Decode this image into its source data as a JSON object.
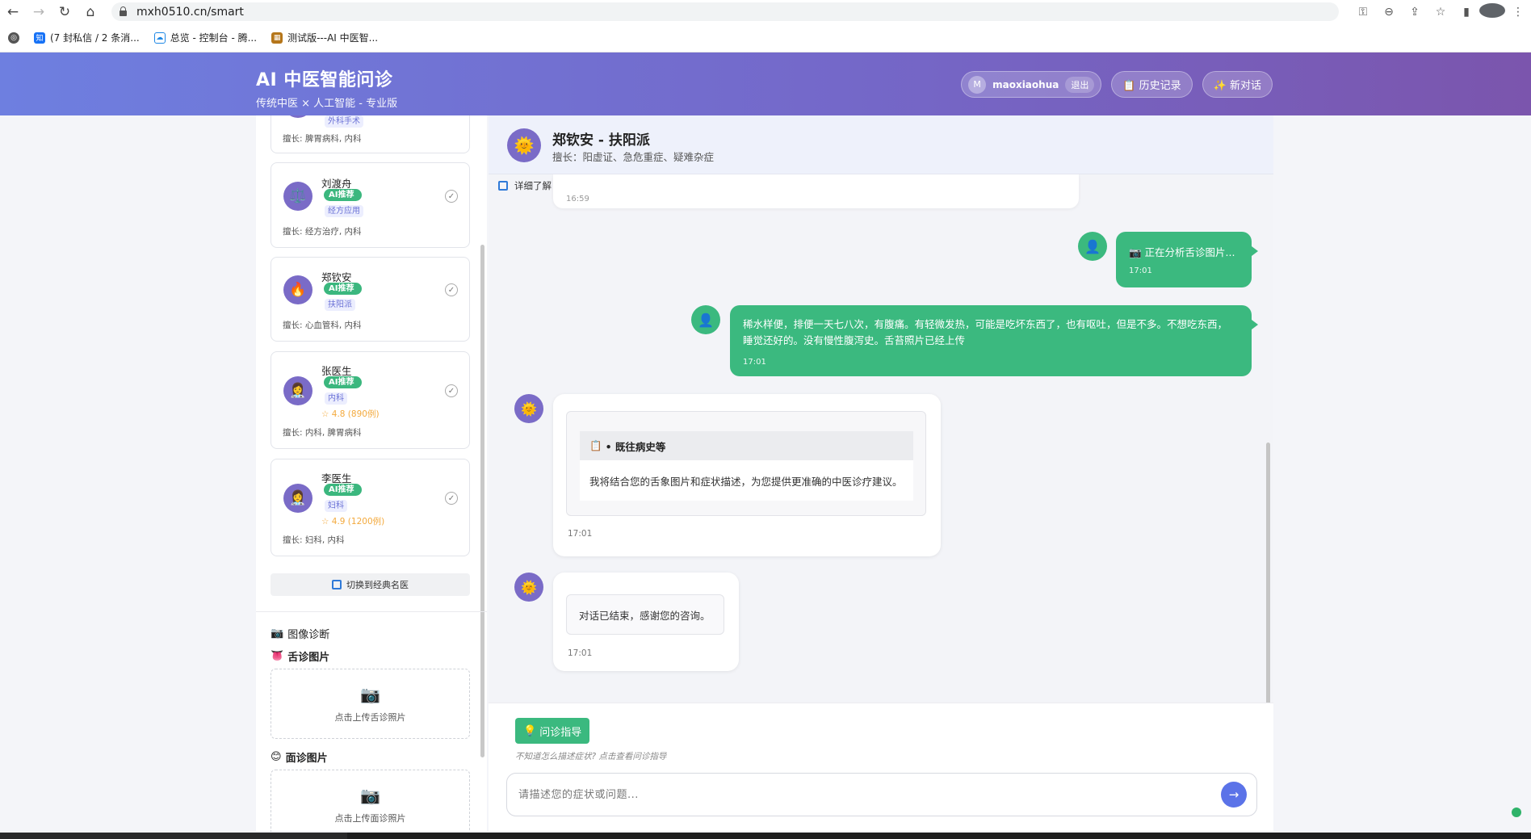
{
  "browser": {
    "url": "mxh0510.cn/smart",
    "bookmarks": [
      {
        "icon": "zhihu-icon",
        "label": "(7 封私信 / 2 条消..."
      },
      {
        "icon": "cloud-icon",
        "label": "总览 - 控制台 - 腾..."
      },
      {
        "icon": "app-icon",
        "label": "测试版---AI 中医智..."
      }
    ]
  },
  "header": {
    "title": "AI 中医智能问诊",
    "subtitle": "传统中医 × 人工智能 - 专业版",
    "user_initial": "M",
    "username": "maoxiaohua",
    "logout_label": "退出",
    "history_label": "📋 历史记录",
    "new_chat_label": "✨ 新对话"
  },
  "sidebar": {
    "partial_card": {
      "tag": "外科手术",
      "specialty": "擅长: 脾胃病科, 内科"
    },
    "doctors": [
      {
        "name": "刘渡舟",
        "badge": "AI推荐",
        "tag": "经方应用",
        "specialty": "擅长: 经方治疗, 内科",
        "rating": "",
        "avatar_icon": "⚖️"
      },
      {
        "name": "郑钦安",
        "badge": "AI推荐",
        "tag": "扶阳派",
        "specialty": "擅长: 心血管科, 内科",
        "rating": "",
        "avatar_icon": "🔥"
      },
      {
        "name": "张医生",
        "badge": "AI推荐",
        "tag": "内科",
        "specialty": "擅长: 内科, 脾胃病科",
        "rating": "4.8 (890例)",
        "avatar_icon": "👩‍⚕️"
      },
      {
        "name": "李医生",
        "badge": "AI推荐",
        "tag": "妇科",
        "specialty": "擅长: 妇科, 内科",
        "rating": "4.9 (1200例)",
        "avatar_icon": "👩‍⚕️"
      }
    ],
    "check_mark": "✓",
    "switch_label": "切换到经典名医",
    "image_diag_title": "图像诊断",
    "tongue_title": "舌诊图片",
    "tongue_upload": "点击上传舌诊照片",
    "face_title": "面诊图片",
    "face_upload": "点击上传面诊照片"
  },
  "chat": {
    "doctor_title": "郑钦安 - 扶阳派",
    "doctor_specialty": "擅长：阳虚证、急危重症、疑难杂症",
    "detail_link": "详细了解",
    "partial_time": "16:59",
    "messages": [
      {
        "role": "user",
        "text": "📷 正在分析舌诊图片...",
        "time": "17:01"
      },
      {
        "role": "user",
        "text": "稀水样便，排便一天七八次，有腹痛。有轻微发热，可能是吃坏东西了，也有呕吐，但是不多。不想吃东西，睡觉还好的。没有慢性腹泻史。舌苔照片已经上传",
        "time": "17:01"
      },
      {
        "role": "bot",
        "heading": "• 既往病史等",
        "text": "我将结合您的舌象图片和症状描述，为您提供更准确的中医诊疗建议。",
        "time": "17:01"
      },
      {
        "role": "bot",
        "text": "对话已结束，感谢您的咨询。",
        "time": "17:01"
      }
    ],
    "guide_label": "问诊指导",
    "guide_hint": "不知道怎么描述症状? 点击查看问诊指导",
    "input_placeholder": "请描述您的症状或问题...",
    "send_icon": "→"
  }
}
